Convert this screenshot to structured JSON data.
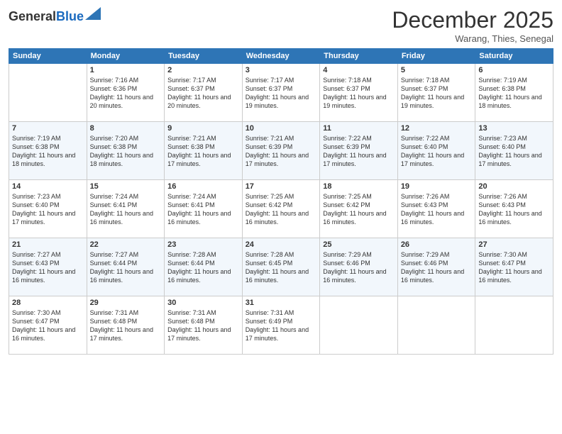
{
  "header": {
    "logo_general": "General",
    "logo_blue": "Blue",
    "month_title": "December 2025",
    "location": "Warang, Thies, Senegal"
  },
  "days_of_week": [
    "Sunday",
    "Monday",
    "Tuesday",
    "Wednesday",
    "Thursday",
    "Friday",
    "Saturday"
  ],
  "weeks": [
    [
      {
        "day": "",
        "sunrise": "",
        "sunset": "",
        "daylight": ""
      },
      {
        "day": "1",
        "sunrise": "Sunrise: 7:16 AM",
        "sunset": "Sunset: 6:36 PM",
        "daylight": "Daylight: 11 hours and 20 minutes."
      },
      {
        "day": "2",
        "sunrise": "Sunrise: 7:17 AM",
        "sunset": "Sunset: 6:37 PM",
        "daylight": "Daylight: 11 hours and 20 minutes."
      },
      {
        "day": "3",
        "sunrise": "Sunrise: 7:17 AM",
        "sunset": "Sunset: 6:37 PM",
        "daylight": "Daylight: 11 hours and 19 minutes."
      },
      {
        "day": "4",
        "sunrise": "Sunrise: 7:18 AM",
        "sunset": "Sunset: 6:37 PM",
        "daylight": "Daylight: 11 hours and 19 minutes."
      },
      {
        "day": "5",
        "sunrise": "Sunrise: 7:18 AM",
        "sunset": "Sunset: 6:37 PM",
        "daylight": "Daylight: 11 hours and 19 minutes."
      },
      {
        "day": "6",
        "sunrise": "Sunrise: 7:19 AM",
        "sunset": "Sunset: 6:38 PM",
        "daylight": "Daylight: 11 hours and 18 minutes."
      }
    ],
    [
      {
        "day": "7",
        "sunrise": "Sunrise: 7:19 AM",
        "sunset": "Sunset: 6:38 PM",
        "daylight": "Daylight: 11 hours and 18 minutes."
      },
      {
        "day": "8",
        "sunrise": "Sunrise: 7:20 AM",
        "sunset": "Sunset: 6:38 PM",
        "daylight": "Daylight: 11 hours and 18 minutes."
      },
      {
        "day": "9",
        "sunrise": "Sunrise: 7:21 AM",
        "sunset": "Sunset: 6:38 PM",
        "daylight": "Daylight: 11 hours and 17 minutes."
      },
      {
        "day": "10",
        "sunrise": "Sunrise: 7:21 AM",
        "sunset": "Sunset: 6:39 PM",
        "daylight": "Daylight: 11 hours and 17 minutes."
      },
      {
        "day": "11",
        "sunrise": "Sunrise: 7:22 AM",
        "sunset": "Sunset: 6:39 PM",
        "daylight": "Daylight: 11 hours and 17 minutes."
      },
      {
        "day": "12",
        "sunrise": "Sunrise: 7:22 AM",
        "sunset": "Sunset: 6:40 PM",
        "daylight": "Daylight: 11 hours and 17 minutes."
      },
      {
        "day": "13",
        "sunrise": "Sunrise: 7:23 AM",
        "sunset": "Sunset: 6:40 PM",
        "daylight": "Daylight: 11 hours and 17 minutes."
      }
    ],
    [
      {
        "day": "14",
        "sunrise": "Sunrise: 7:23 AM",
        "sunset": "Sunset: 6:40 PM",
        "daylight": "Daylight: 11 hours and 17 minutes."
      },
      {
        "day": "15",
        "sunrise": "Sunrise: 7:24 AM",
        "sunset": "Sunset: 6:41 PM",
        "daylight": "Daylight: 11 hours and 16 minutes."
      },
      {
        "day": "16",
        "sunrise": "Sunrise: 7:24 AM",
        "sunset": "Sunset: 6:41 PM",
        "daylight": "Daylight: 11 hours and 16 minutes."
      },
      {
        "day": "17",
        "sunrise": "Sunrise: 7:25 AM",
        "sunset": "Sunset: 6:42 PM",
        "daylight": "Daylight: 11 hours and 16 minutes."
      },
      {
        "day": "18",
        "sunrise": "Sunrise: 7:25 AM",
        "sunset": "Sunset: 6:42 PM",
        "daylight": "Daylight: 11 hours and 16 minutes."
      },
      {
        "day": "19",
        "sunrise": "Sunrise: 7:26 AM",
        "sunset": "Sunset: 6:43 PM",
        "daylight": "Daylight: 11 hours and 16 minutes."
      },
      {
        "day": "20",
        "sunrise": "Sunrise: 7:26 AM",
        "sunset": "Sunset: 6:43 PM",
        "daylight": "Daylight: 11 hours and 16 minutes."
      }
    ],
    [
      {
        "day": "21",
        "sunrise": "Sunrise: 7:27 AM",
        "sunset": "Sunset: 6:43 PM",
        "daylight": "Daylight: 11 hours and 16 minutes."
      },
      {
        "day": "22",
        "sunrise": "Sunrise: 7:27 AM",
        "sunset": "Sunset: 6:44 PM",
        "daylight": "Daylight: 11 hours and 16 minutes."
      },
      {
        "day": "23",
        "sunrise": "Sunrise: 7:28 AM",
        "sunset": "Sunset: 6:44 PM",
        "daylight": "Daylight: 11 hours and 16 minutes."
      },
      {
        "day": "24",
        "sunrise": "Sunrise: 7:28 AM",
        "sunset": "Sunset: 6:45 PM",
        "daylight": "Daylight: 11 hours and 16 minutes."
      },
      {
        "day": "25",
        "sunrise": "Sunrise: 7:29 AM",
        "sunset": "Sunset: 6:46 PM",
        "daylight": "Daylight: 11 hours and 16 minutes."
      },
      {
        "day": "26",
        "sunrise": "Sunrise: 7:29 AM",
        "sunset": "Sunset: 6:46 PM",
        "daylight": "Daylight: 11 hours and 16 minutes."
      },
      {
        "day": "27",
        "sunrise": "Sunrise: 7:30 AM",
        "sunset": "Sunset: 6:47 PM",
        "daylight": "Daylight: 11 hours and 16 minutes."
      }
    ],
    [
      {
        "day": "28",
        "sunrise": "Sunrise: 7:30 AM",
        "sunset": "Sunset: 6:47 PM",
        "daylight": "Daylight: 11 hours and 16 minutes."
      },
      {
        "day": "29",
        "sunrise": "Sunrise: 7:31 AM",
        "sunset": "Sunset: 6:48 PM",
        "daylight": "Daylight: 11 hours and 17 minutes."
      },
      {
        "day": "30",
        "sunrise": "Sunrise: 7:31 AM",
        "sunset": "Sunset: 6:48 PM",
        "daylight": "Daylight: 11 hours and 17 minutes."
      },
      {
        "day": "31",
        "sunrise": "Sunrise: 7:31 AM",
        "sunset": "Sunset: 6:49 PM",
        "daylight": "Daylight: 11 hours and 17 minutes."
      },
      {
        "day": "",
        "sunrise": "",
        "sunset": "",
        "daylight": ""
      },
      {
        "day": "",
        "sunrise": "",
        "sunset": "",
        "daylight": ""
      },
      {
        "day": "",
        "sunrise": "",
        "sunset": "",
        "daylight": ""
      }
    ]
  ]
}
